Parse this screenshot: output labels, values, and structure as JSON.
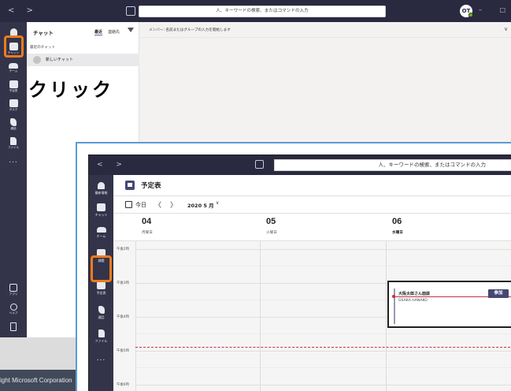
{
  "background_window": {
    "titlebar": {
      "nav": "< >",
      "search_placeholder": "人、キーワードの検索、またはコマンドの入力",
      "avatar_initials": "OT",
      "window_controls": "– □ ×"
    },
    "rail": [
      {
        "id": "activity",
        "label": ""
      },
      {
        "id": "chat",
        "label": "チャット"
      },
      {
        "id": "teams",
        "label": "チーム"
      },
      {
        "id": "calendar",
        "label": "予定表"
      },
      {
        "id": "assignments",
        "label": "タスク"
      },
      {
        "id": "calls",
        "label": "通話"
      },
      {
        "id": "files",
        "label": "ファイル"
      },
      {
        "id": "more",
        "label": "..."
      },
      {
        "id": "apps",
        "label": "アプリ"
      },
      {
        "id": "help",
        "label": "ヘルプ"
      }
    ],
    "chat_panel": {
      "title": "チャット",
      "tab_recent": "最近",
      "tab_contacts": "連絡先",
      "recent_header": "最近のチャット",
      "new_chat": "新しいチャット"
    },
    "annotation_text": "クリック",
    "main": {
      "to_label": "メンバー: 名前またはグループの入力を開始します",
      "chevron": "∨"
    },
    "copyright": "ight Microsoft Corporation"
  },
  "calendar_window": {
    "titlebar": {
      "nav": "< >",
      "search_placeholder": "人、キーワードの検索、またはコマンドの入力"
    },
    "rail": [
      {
        "id": "activity",
        "label": "最新情報"
      },
      {
        "id": "chat",
        "label": "チャット"
      },
      {
        "id": "teams",
        "label": "チーム"
      },
      {
        "id": "assignments",
        "label": "課題"
      },
      {
        "id": "calendar",
        "label": "予定表"
      },
      {
        "id": "calls",
        "label": "通話"
      },
      {
        "id": "files",
        "label": "ファイル"
      },
      {
        "id": "more",
        "label": "..."
      }
    ],
    "header": {
      "title": "予定表"
    },
    "toolbar": {
      "today": "今日",
      "prev": "〈",
      "next": "〉",
      "month": "2020 5 月",
      "month_chevron": "∨"
    },
    "days": [
      {
        "num": "04",
        "name": "月曜日",
        "today": false
      },
      {
        "num": "05",
        "name": "火曜日",
        "today": false
      },
      {
        "num": "06",
        "name": "水曜日",
        "today": true
      }
    ],
    "times": [
      "午後2時",
      "午後3時",
      "午後4時",
      "午後5時",
      "午後6時"
    ],
    "meeting": {
      "title": "大阪太郎さん面談",
      "organizer": "OSAKA HANAKO",
      "join_label": "参加"
    },
    "colors": {
      "titlebar": "#292940",
      "rail": "#33344a",
      "highlight": "#ef7b1d",
      "accent": "#464775",
      "now_line": "#c4314b"
    }
  }
}
